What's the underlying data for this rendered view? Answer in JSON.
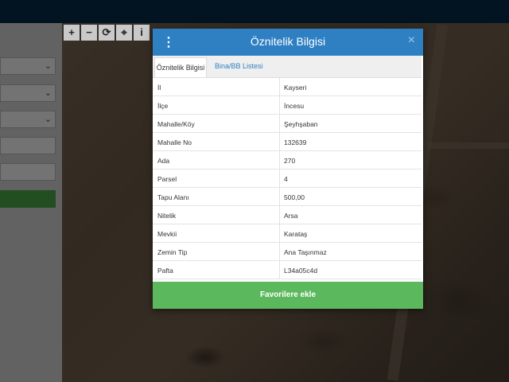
{
  "map_toolbar": [
    {
      "icon": "plus-icon",
      "glyph": "+"
    },
    {
      "icon": "minus-icon",
      "glyph": "−"
    },
    {
      "icon": "refresh-icon",
      "glyph": "⟳"
    },
    {
      "icon": "locate-icon",
      "glyph": "⌖"
    },
    {
      "icon": "info-icon",
      "glyph": "i"
    }
  ],
  "dialog": {
    "title": "Öznitelik Bilgisi",
    "close_glyph": "×",
    "menu_glyph": "⋮",
    "tabs": [
      {
        "label": "Öznitelik Bilgisi",
        "active": true
      },
      {
        "label": "Bina/BB Listesi",
        "active": false
      }
    ],
    "rows": [
      {
        "key": "İl",
        "value": "Kayseri"
      },
      {
        "key": "İlçe",
        "value": "İncesu"
      },
      {
        "key": "Mahalle/Köy",
        "value": "Şeyhşaban"
      },
      {
        "key": "Mahalle No",
        "value": "132639"
      },
      {
        "key": "Ada",
        "value": "270"
      },
      {
        "key": "Parsel",
        "value": "4"
      },
      {
        "key": "Tapu Alanı",
        "value": "500,00"
      },
      {
        "key": "Nitelik",
        "value": "Arsa"
      },
      {
        "key": "Mevkii",
        "value": "Karataş"
      },
      {
        "key": "Zemin Tip",
        "value": "Ana Taşınmaz"
      },
      {
        "key": "Pafta",
        "value": "L34a05c4d"
      }
    ],
    "favorite_button": "Favorilere ekle"
  },
  "sidebar": {
    "dropdown_glyph": "⌄"
  }
}
